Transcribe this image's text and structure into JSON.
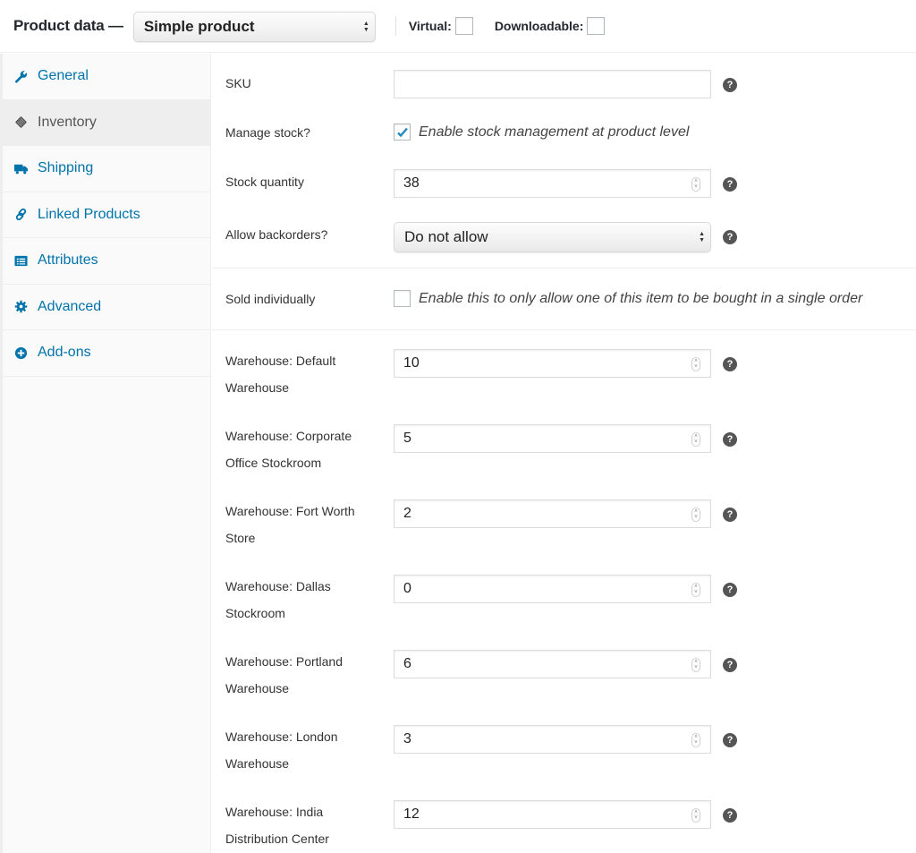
{
  "header": {
    "title": "Product data —",
    "product_type": "Simple product",
    "virtual_label": "Virtual:",
    "virtual_checked": false,
    "downloadable_label": "Downloadable:",
    "downloadable_checked": false
  },
  "sidebar": {
    "items": [
      {
        "label": "General",
        "icon": "wrench-icon",
        "active": false
      },
      {
        "label": "Inventory",
        "icon": "tag-icon",
        "active": true
      },
      {
        "label": "Shipping",
        "icon": "truck-icon",
        "active": false
      },
      {
        "label": "Linked Products",
        "icon": "link-icon",
        "active": false
      },
      {
        "label": "Attributes",
        "icon": "list-icon",
        "active": false
      },
      {
        "label": "Advanced",
        "icon": "gear-icon",
        "active": false
      },
      {
        "label": "Add-ons",
        "icon": "plus-circle-icon",
        "active": false
      }
    ]
  },
  "inventory": {
    "sku": {
      "label": "SKU",
      "value": ""
    },
    "manage_stock": {
      "label": "Manage stock?",
      "checked": true,
      "description": "Enable stock management at product level"
    },
    "stock_quantity": {
      "label": "Stock quantity",
      "value": "38"
    },
    "backorders": {
      "label": "Allow backorders?",
      "value": "Do not allow"
    },
    "sold_individually": {
      "label": "Sold individually",
      "checked": false,
      "description": "Enable this to only allow one of this item to be bought in a single order"
    },
    "warehouses": [
      {
        "label_line1": "Warehouse: Default",
        "label_line2": "Warehouse",
        "value": "10"
      },
      {
        "label_line1": "Warehouse: Corporate",
        "label_line2": "Office Stockroom",
        "value": "5"
      },
      {
        "label_line1": "Warehouse: Fort Worth",
        "label_line2": "Store",
        "value": "2"
      },
      {
        "label_line1": "Warehouse: Dallas",
        "label_line2": "Stockroom",
        "value": "0"
      },
      {
        "label_line1": "Warehouse: Portland",
        "label_line2": "Warehouse",
        "value": "6"
      },
      {
        "label_line1": "Warehouse: London",
        "label_line2": "Warehouse",
        "value": "3"
      },
      {
        "label_line1": "Warehouse: India",
        "label_line2": "Distribution Center",
        "value": "12"
      }
    ]
  },
  "help_glyph": "?",
  "colors": {
    "link": "#0073aa",
    "checkmark": "#1e8cbe"
  }
}
